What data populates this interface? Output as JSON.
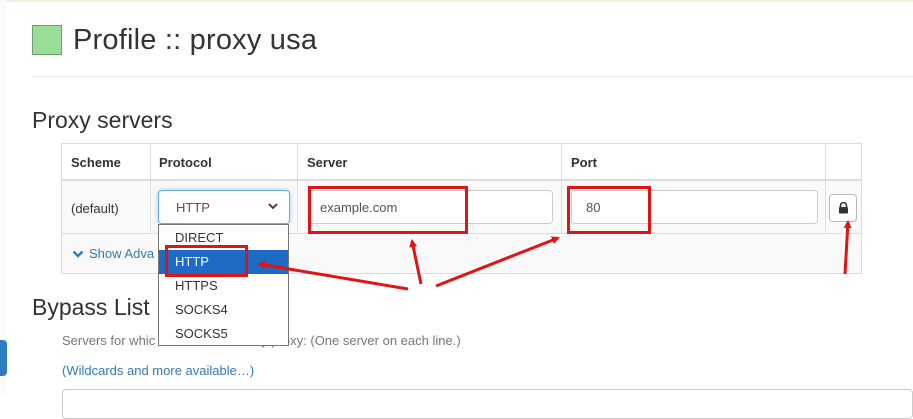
{
  "page": {
    "title": "Profile :: proxy usa",
    "profile_color": "#99dd99",
    "accent_color": "#337ab7",
    "annotation_color": "#e01414"
  },
  "proxy_servers": {
    "section_title": "Proxy servers",
    "columns": [
      "Scheme",
      "Protocol",
      "Server",
      "Port"
    ],
    "row": {
      "scheme": "(default)",
      "protocol": "HTTP",
      "server": "example.com",
      "port": "80",
      "lock_icon": "lock-icon"
    },
    "show_advanced": "Show Adva",
    "protocol_dropdown": {
      "options": [
        "DIRECT",
        "HTTP",
        "HTTPS",
        "SOCKS4",
        "SOCKS5"
      ],
      "selected": "HTTP"
    }
  },
  "bypass": {
    "section_title": "Bypass List",
    "description": "Servers for which you do not want to use any proxy: (One server on each line.)",
    "description_left": "Servers for whic",
    "description_right": "use any proxy: (One server on each line.)",
    "wildcards_link": "(Wildcards and more available…)"
  }
}
